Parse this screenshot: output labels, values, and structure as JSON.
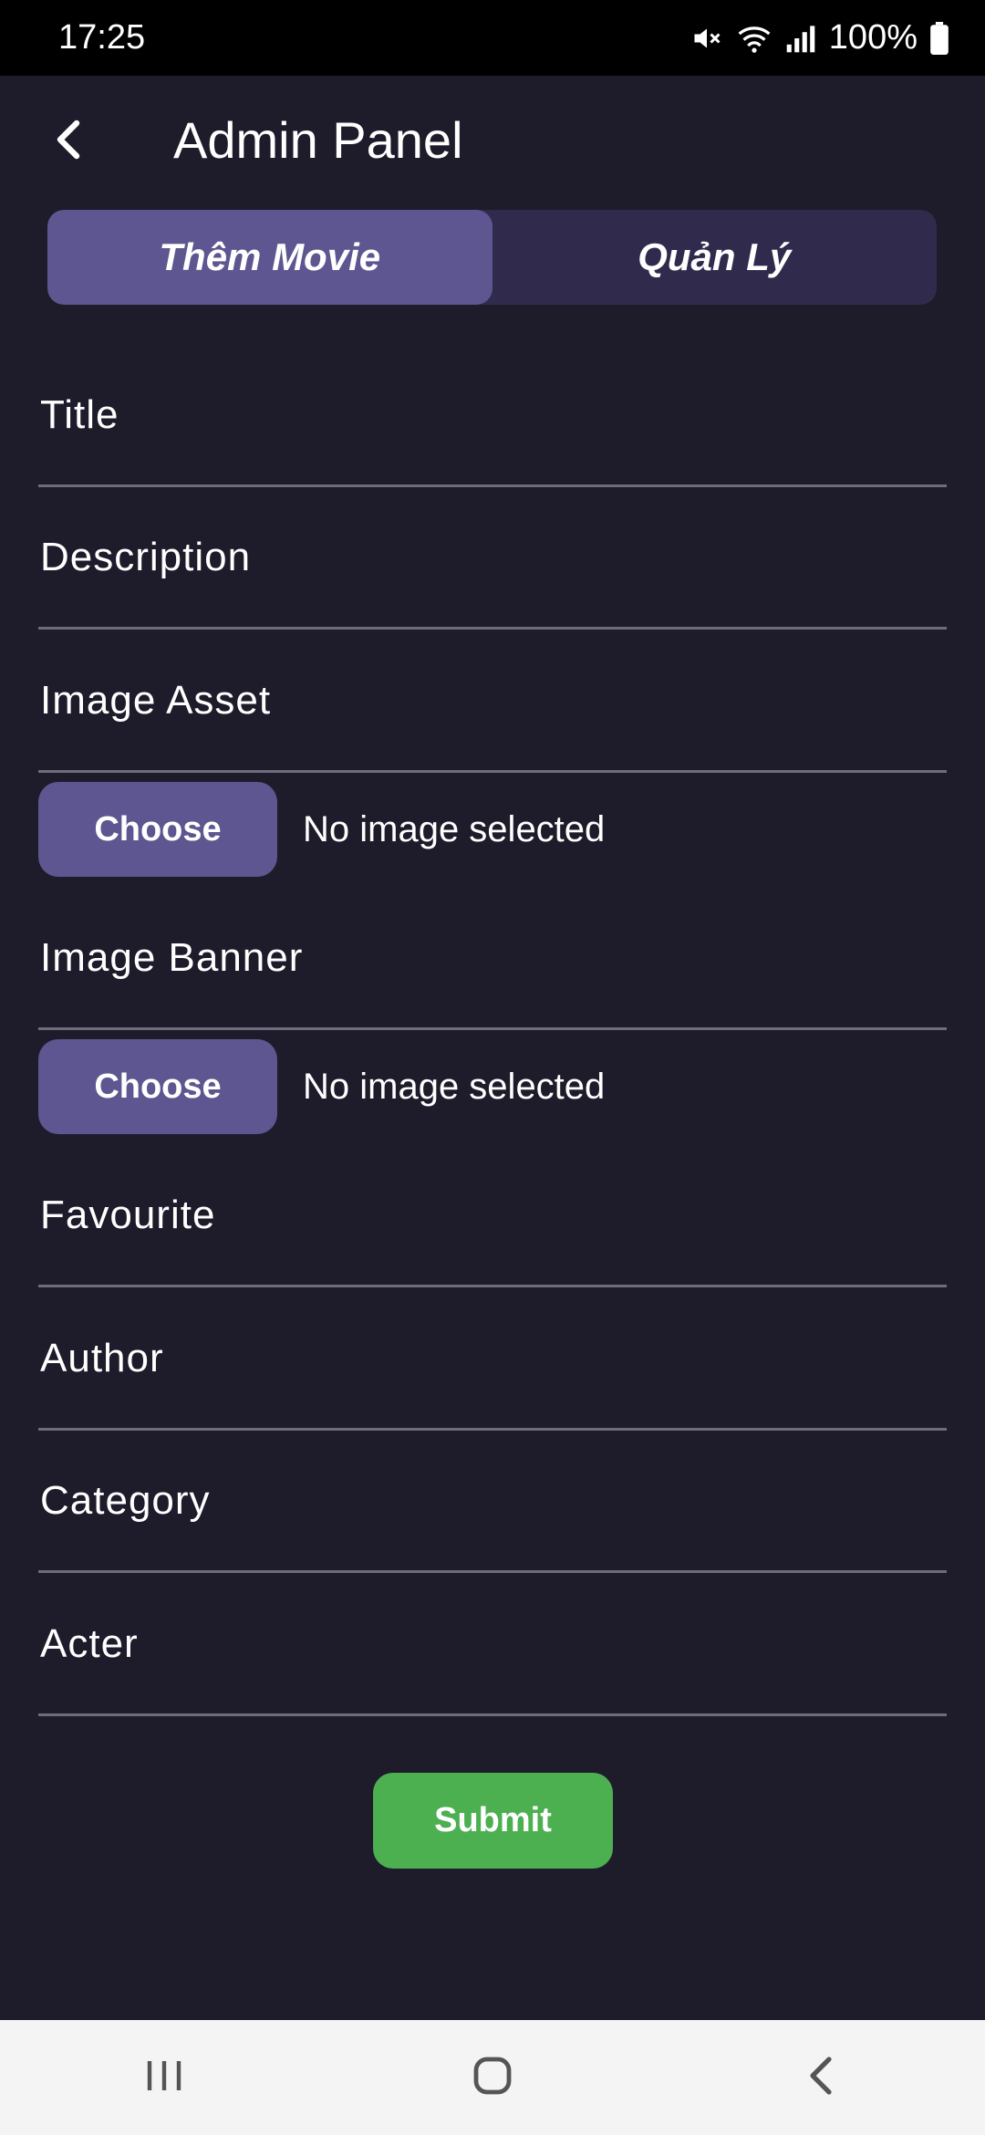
{
  "status_bar": {
    "time": "17:25",
    "battery": "100%",
    "icons": [
      "mute-icon",
      "wifi-icon",
      "signal-icon",
      "battery-icon"
    ]
  },
  "app_bar": {
    "title": "Admin Panel",
    "back_icon": "chevron-left-icon"
  },
  "tabs": [
    {
      "label": "Thêm Movie",
      "active": true
    },
    {
      "label": "Quản Lý",
      "active": false
    }
  ],
  "form": {
    "title_label": "Title",
    "description_label": "Description",
    "image_asset_label": "Image Asset",
    "image_asset_button": "Choose",
    "image_asset_status": "No image selected",
    "image_banner_label": "Image Banner",
    "image_banner_button": "Choose",
    "image_banner_status": "No image selected",
    "favourite_label": "Favourite",
    "author_label": "Author",
    "category_label": "Category",
    "acter_label": "Acter",
    "submit_label": "Submit"
  },
  "nav_bar": {
    "icons": [
      "recents-icon",
      "home-icon",
      "back-icon"
    ]
  },
  "colors": {
    "background": "#1e1b2a",
    "tab_active": "#5e5690",
    "tab_inactive": "#302b4d",
    "button": "#5e5690",
    "submit": "#4caf50"
  }
}
